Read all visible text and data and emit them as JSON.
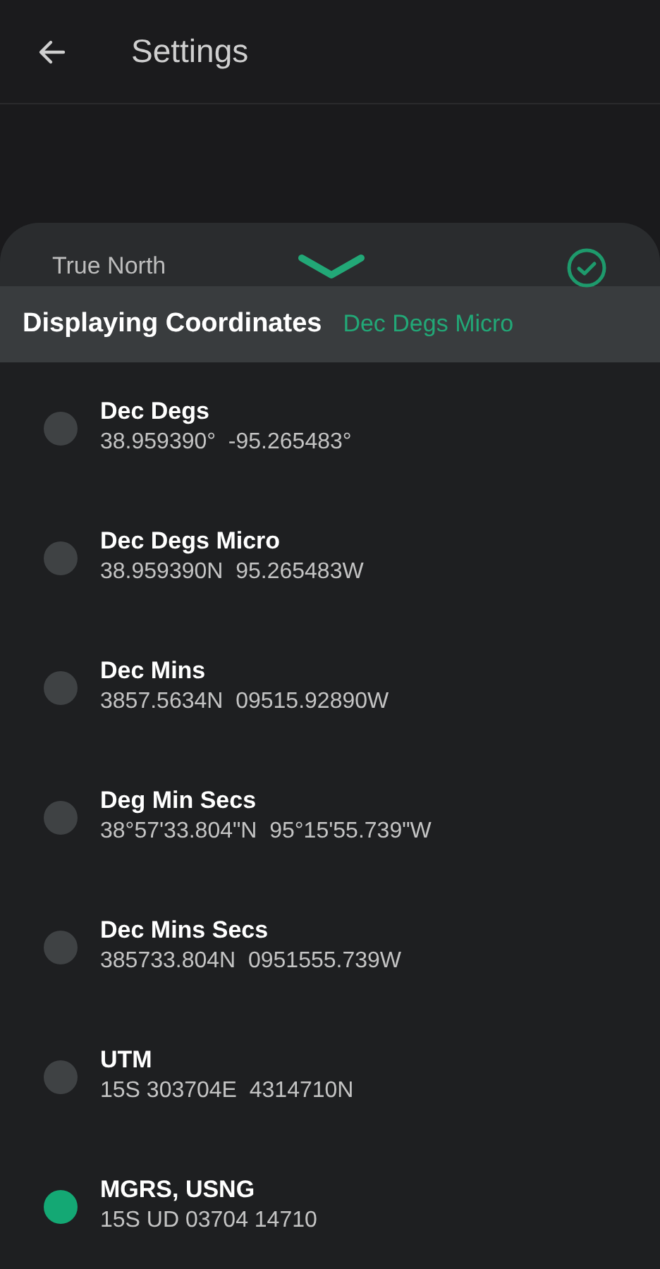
{
  "app_bar": {
    "title": "Settings"
  },
  "sheet": {
    "row_label": "True North",
    "row_checked": true
  },
  "header": {
    "title": "Displaying Coordinates",
    "value": "Dec Degs Micro"
  },
  "options": [
    {
      "name": "Dec Degs",
      "value": "38.959390°  -95.265483°",
      "selected": false
    },
    {
      "name": "Dec Degs Micro",
      "value": "38.959390N  95.265483W",
      "selected": false
    },
    {
      "name": "Dec Mins",
      "value": "3857.5634N  09515.92890W",
      "selected": false
    },
    {
      "name": "Deg Min Secs",
      "value": "38°57'33.804\"N  95°15'55.739\"W",
      "selected": false
    },
    {
      "name": "Dec Mins Secs",
      "value": "385733.804N  0951555.739W",
      "selected": false
    },
    {
      "name": "UTM",
      "value": "15S 303704E  4314710N",
      "selected": false
    },
    {
      "name": "MGRS, USNG",
      "value": "15S UD 03704 14710",
      "selected": true
    }
  ]
}
